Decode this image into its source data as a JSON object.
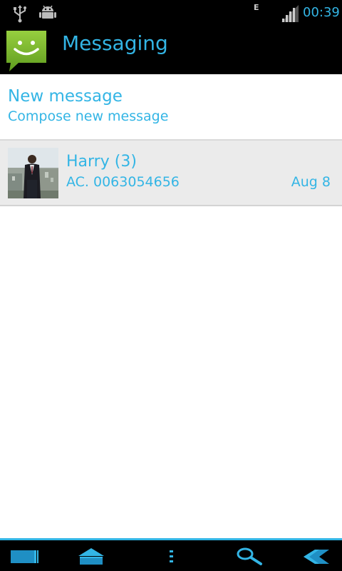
{
  "status_bar": {
    "network_type": "E",
    "time": "00:39",
    "icons": [
      "usb-icon",
      "bugdroid-debug-icon",
      "signal-icon"
    ]
  },
  "action_bar": {
    "app_icon": "messaging-smiley-icon",
    "title": "Messaging"
  },
  "new_message": {
    "title": "New message",
    "subtitle": "Compose new message"
  },
  "conversations": [
    {
      "name": "Harry (3)",
      "snippet": "AC. 0063054656",
      "date": "Aug 8",
      "avatar": "contact-photo"
    }
  ],
  "nav_bar": {
    "buttons": [
      "recent-apps-icon",
      "home-icon",
      "menu-icon",
      "search-icon",
      "back-icon"
    ]
  },
  "colors": {
    "accent": "#33b5e5",
    "app_icon_green": "#7cb82f",
    "row_bg": "#ebebeb",
    "bar_bg": "#000000"
  }
}
